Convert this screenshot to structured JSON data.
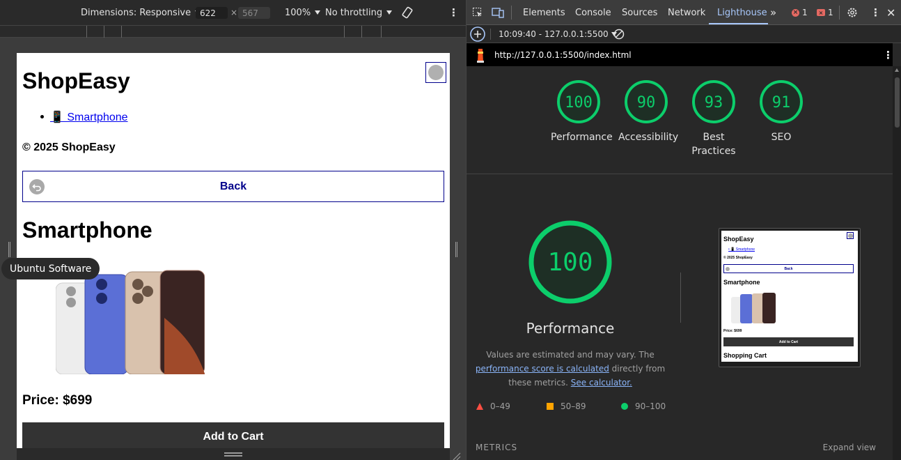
{
  "device_toolbar": {
    "dimensions_label": "Dimensions: Responsive",
    "width": "622",
    "height": "567",
    "zoom": "100%",
    "throttling": "No throttling"
  },
  "site": {
    "title": "ShopEasy",
    "nav_item": "📱 Smartphone",
    "copyright": "© 2025 ShopEasy",
    "back_label": "Back",
    "product_title": "Smartphone",
    "price": "Price: $699",
    "add_to_cart": "Add to Cart"
  },
  "tooltip": "Ubuntu Software",
  "devtools": {
    "tabs": [
      "Elements",
      "Console",
      "Sources",
      "Network",
      "Lighthouse"
    ],
    "active_tab": "Lighthouse",
    "error_count": "1",
    "issue_count": "1",
    "report_selector": "10:09:40 - 127.0.0.1:5500",
    "url": "http://127.0.0.1:5500/index.html"
  },
  "scores": [
    {
      "value": 100,
      "label": "Performance"
    },
    {
      "value": 90,
      "label": "Accessibility"
    },
    {
      "value": 93,
      "label": "Best Practices"
    },
    {
      "value": 91,
      "label": "SEO"
    }
  ],
  "performance": {
    "score": 100,
    "title": "Performance",
    "desc_1": "Values are estimated and may vary. The",
    "desc_link_1": "performance score is calculated",
    "desc_2": "directly from these metrics.",
    "desc_link_2": "See calculator."
  },
  "thumbnail": {
    "title": "ShopEasy",
    "nav_item": "Smartphone",
    "copyright": "© 2025 ShopEasy",
    "back": "Back",
    "product": "Smartphone",
    "price": "Price: $699",
    "add": "Add to Cart",
    "cart": "Shopping Cart"
  },
  "legend": {
    "fail": "0–49",
    "average": "50–89",
    "pass": "90–100"
  },
  "metrics_header": "METRICS",
  "expand_view": "Expand view",
  "colors": {
    "pass": "#0cce6b",
    "average": "#ffa400",
    "fail": "#ff4e42",
    "accent": "#a8c7fa"
  }
}
